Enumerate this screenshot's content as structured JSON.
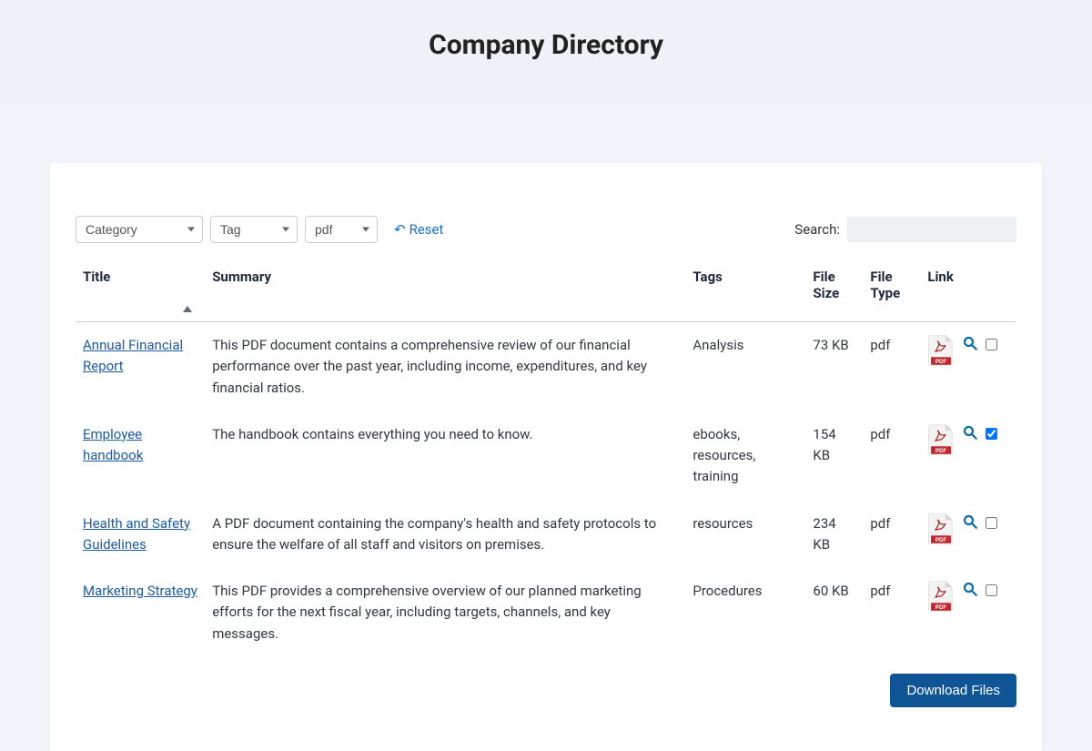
{
  "header": {
    "title": "Company Directory"
  },
  "filters": {
    "category_label": "Category",
    "tag_label": "Tag",
    "type_value": "pdf",
    "reset_label": "Reset"
  },
  "search": {
    "label": "Search:",
    "value": ""
  },
  "table": {
    "columns": {
      "title": "Title",
      "summary": "Summary",
      "tags": "Tags",
      "file_size": "File Size",
      "file_type": "File Type",
      "link": "Link"
    },
    "rows": [
      {
        "title": "Annual Financial Report",
        "summary": "This PDF document contains a comprehensive review of our financial performance over the past year, including income, expenditures, and key financial ratios.",
        "tags": "Analysis",
        "size": "73 KB",
        "type": "pdf",
        "checked": false
      },
      {
        "title": "Employee handbook",
        "summary": "The handbook contains everything you need to know.",
        "tags": "ebooks, resources, training",
        "size": "154 KB",
        "type": "pdf",
        "checked": true
      },
      {
        "title": "Health and Safety Guidelines",
        "summary": "A PDF document containing the company's health and safety protocols to ensure the welfare of all staff and visitors on premises.",
        "tags": "resources",
        "size": "234 KB",
        "type": "pdf",
        "checked": false
      },
      {
        "title": "Marketing Strategy",
        "summary": "This PDF provides a comprehensive overview of our planned marketing efforts for the next fiscal year, including targets, channels, and key messages.",
        "tags": "Procedures",
        "size": "60 KB",
        "type": "pdf",
        "checked": false
      }
    ]
  },
  "actions": {
    "download_label": "Download Files"
  }
}
